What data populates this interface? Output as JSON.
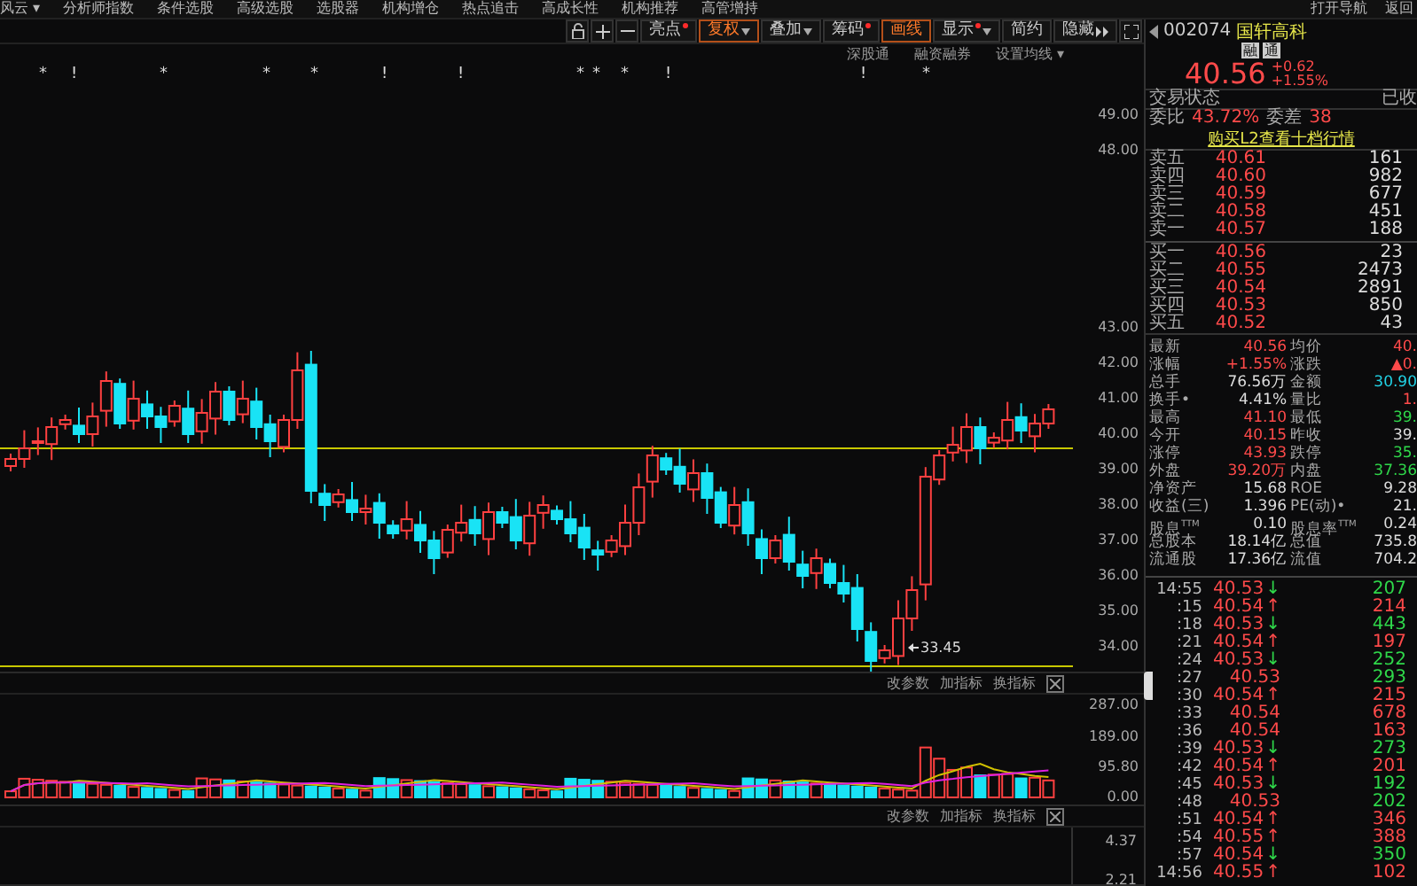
{
  "menu": {
    "items": [
      "风云 ▾",
      "分析师指数",
      "条件选股",
      "高级选股",
      "选股器",
      "机构增仓",
      "热点追击",
      "高成长性",
      "机构推荐",
      "高管增持"
    ],
    "right": [
      "打开导航",
      "返回"
    ]
  },
  "toolbar": [
    {
      "label": "亮点",
      "dot": true,
      "caret": false,
      "highlighted": false
    },
    {
      "label": "复权",
      "dot": false,
      "caret": true,
      "highlighted": true
    },
    {
      "label": "叠加",
      "dot": false,
      "caret": true,
      "highlighted": false
    },
    {
      "label": "筹码",
      "dot": true,
      "caret": false,
      "highlighted": false
    },
    {
      "label": "画线",
      "dot": false,
      "caret": false,
      "highlighted": true
    },
    {
      "label": "显示",
      "dot": true,
      "caret": true,
      "highlighted": false
    },
    {
      "label": "简约",
      "dot": false,
      "caret": false,
      "highlighted": false
    },
    {
      "label": "隐藏",
      "dot": false,
      "caret": false,
      "highlighted": false
    }
  ],
  "chart_links": [
    "深股通",
    "融资融券",
    "设置均线 ▾"
  ],
  "markers": [
    "*",
    "!",
    "*",
    "*",
    "*",
    "!",
    "!",
    "*",
    "*",
    "*",
    "!",
    "!",
    "*"
  ],
  "price_axis": [
    "49.00",
    "48.00",
    "43.00",
    "42.00",
    "41.00",
    "40.00",
    "39.00",
    "38.00",
    "37.00",
    "36.00",
    "35.00",
    "34.00"
  ],
  "low_marker": "33.45",
  "panes": [
    {
      "buttons": [
        "改参数",
        "加指标",
        "换指标"
      ],
      "axis": [
        "287.00",
        "189.00",
        "95.80",
        "0.00"
      ]
    },
    {
      "buttons": [
        "改参数",
        "加指标",
        "换指标"
      ],
      "axis": [
        "4.37",
        "2.21"
      ]
    }
  ],
  "quote": {
    "code": "002074",
    "name": "国轩高科",
    "badges": [
      "融",
      "通"
    ],
    "price": "40.56",
    "change": "+0.62",
    "change_pct": "+1.55%"
  },
  "status": {
    "label": "交易状态",
    "value": "已收"
  },
  "ratio": [
    {
      "label": "委比",
      "value": "43.72%"
    },
    {
      "label": "委差",
      "value": "38"
    }
  ],
  "l2_link": "购买L2查看十档行情",
  "asks": [
    {
      "label": "卖五",
      "price": "40.61",
      "volume": "161"
    },
    {
      "label": "卖四",
      "price": "40.60",
      "volume": "982"
    },
    {
      "label": "卖三",
      "price": "40.59",
      "volume": "677"
    },
    {
      "label": "卖二",
      "price": "40.58",
      "volume": "451"
    },
    {
      "label": "卖一",
      "price": "40.57",
      "volume": "188"
    }
  ],
  "bids": [
    {
      "label": "买一",
      "price": "40.56",
      "volume": "23"
    },
    {
      "label": "买二",
      "price": "40.55",
      "volume": "2473"
    },
    {
      "label": "买三",
      "price": "40.54",
      "volume": "2891"
    },
    {
      "label": "买四",
      "price": "40.53",
      "volume": "850"
    },
    {
      "label": "买五",
      "price": "40.52",
      "volume": "43"
    }
  ],
  "stats": [
    {
      "label": "最新",
      "value": "40.56",
      "color": "#ff4a4a"
    },
    {
      "label": "均价",
      "value": "40.",
      "color": "#ff4a4a"
    },
    {
      "label": "涨幅",
      "value": "+1.55%",
      "color": "#ff4a4a"
    },
    {
      "label": "涨跌",
      "value": "▲0.",
      "color": "#ff4a4a"
    },
    {
      "label": "总手",
      "value": "76.56万",
      "color": "#dddddd"
    },
    {
      "label": "金额",
      "value": "30.90",
      "color": "#22d3e6"
    },
    {
      "label": "换手•",
      "value": "4.41%",
      "color": "#dddddd"
    },
    {
      "label": "量比",
      "value": "1.",
      "color": "#ff4a4a"
    },
    {
      "label": "最高",
      "value": "41.10",
      "color": "#ff4a4a"
    },
    {
      "label": "最低",
      "value": "39.",
      "color": "#2fd84a"
    },
    {
      "label": "今开",
      "value": "40.15",
      "color": "#ff4a4a"
    },
    {
      "label": "昨收",
      "value": "39.",
      "color": "#dddddd"
    },
    {
      "label": "涨停",
      "value": "43.93",
      "color": "#ff4a4a"
    },
    {
      "label": "跌停",
      "value": "35.",
      "color": "#2fd84a"
    },
    {
      "label": "外盘",
      "value": "39.20万",
      "color": "#ff4a4a"
    },
    {
      "label": "内盘",
      "value": "37.36",
      "color": "#2fd84a"
    },
    {
      "label": "净资产",
      "value": "15.68",
      "color": "#dddddd"
    },
    {
      "label": "ROE",
      "value": "9.28",
      "color": "#dddddd"
    },
    {
      "label": "收益(三)",
      "value": "1.396",
      "color": "#dddddd"
    },
    {
      "label": "PE(动)•",
      "value": "21.",
      "color": "#dddddd"
    },
    {
      "label": "股息$^{TTM}$",
      "value": "0.10",
      "color": "#dddddd"
    },
    {
      "label": "股息率$^{TTM}$",
      "value": "0.24",
      "color": "#dddddd"
    },
    {
      "label": "总股本",
      "value": "18.14亿",
      "color": "#dddddd"
    },
    {
      "label": "总值",
      "value": "735.8",
      "color": "#dddddd"
    },
    {
      "label": "流通股",
      "value": "17.36亿",
      "color": "#dddddd"
    },
    {
      "label": "流值",
      "value": "704.2",
      "color": "#dddddd"
    }
  ],
  "ticks": [
    {
      "time": "14:55",
      "price": "40.53",
      "arrow": "↓",
      "volume": "207",
      "buy": false
    },
    {
      "time": ":15",
      "price": "40.54",
      "arrow": "↑",
      "volume": "214",
      "buy": true
    },
    {
      "time": ":18",
      "price": "40.53",
      "arrow": "↓",
      "volume": "443",
      "buy": false
    },
    {
      "time": ":21",
      "price": "40.54",
      "arrow": "↑",
      "volume": "197",
      "buy": true
    },
    {
      "time": ":24",
      "price": "40.53",
      "arrow": "↓",
      "volume": "252",
      "buy": false
    },
    {
      "time": ":27",
      "price": "40.53",
      "volume": "293",
      "buy": false
    },
    {
      "time": ":30",
      "price": "40.54",
      "arrow": "↑",
      "volume": "215",
      "buy": true
    },
    {
      "time": ":33",
      "price": "40.54",
      "volume": "678",
      "buy": true
    },
    {
      "time": ":36",
      "price": "40.54",
      "volume": "163",
      "buy": true
    },
    {
      "time": ":39",
      "price": "40.53",
      "arrow": "↓",
      "volume": "273",
      "buy": false
    },
    {
      "time": ":42",
      "price": "40.54",
      "arrow": "↑",
      "volume": "201",
      "buy": true
    },
    {
      "time": ":45",
      "price": "40.53",
      "arrow": "↓",
      "volume": "192",
      "buy": false
    },
    {
      "time": ":48",
      "price": "40.53",
      "volume": "202",
      "buy": false
    },
    {
      "time": ":51",
      "price": "40.54",
      "arrow": "↑",
      "volume": "346",
      "buy": true
    },
    {
      "time": ":54",
      "price": "40.55",
      "arrow": "↑",
      "volume": "388",
      "buy": true
    },
    {
      "time": ":57",
      "price": "40.54",
      "arrow": "↓",
      "volume": "350",
      "buy": false
    },
    {
      "time": "14:56",
      "price": "40.55",
      "arrow": "↑",
      "volume": "102",
      "buy": true
    }
  ]
}
